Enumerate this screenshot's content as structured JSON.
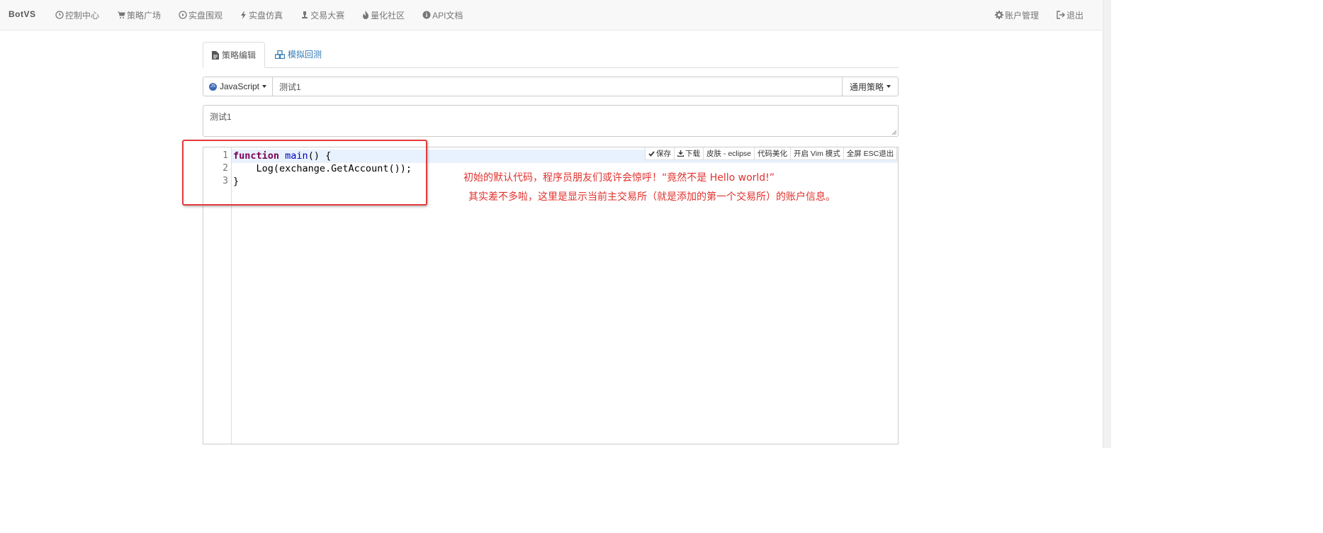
{
  "nav": {
    "brand": "BotVS",
    "items": [
      {
        "label": "控制中心",
        "icon": "clock-icon"
      },
      {
        "label": "策略广场",
        "icon": "cart-icon"
      },
      {
        "label": "实盘围观",
        "icon": "play-circle-icon"
      },
      {
        "label": "实盘仿真",
        "icon": "bolt-icon"
      },
      {
        "label": "交易大赛",
        "icon": "trophy-icon"
      },
      {
        "label": "量化社区",
        "icon": "fire-icon"
      },
      {
        "label": "API文档",
        "icon": "info-icon"
      }
    ],
    "right": [
      {
        "label": "账户管理",
        "icon": "gear-icon"
      },
      {
        "label": "退出",
        "icon": "logout-icon"
      }
    ]
  },
  "tabs": [
    {
      "label": "策略编辑",
      "icon": "file-icon",
      "active": true
    },
    {
      "label": "模拟回测",
      "icon": "cubes-icon",
      "active": false
    }
  ],
  "strategy": {
    "language": "JavaScript",
    "language_badge": "JS",
    "name": "测试1",
    "type": "通用策略",
    "description": "测试1"
  },
  "editor": {
    "toolbar": [
      {
        "label": "保存",
        "icon": "check-icon"
      },
      {
        "label": "下载",
        "icon": "download-icon"
      },
      {
        "label": "皮肤 - eclipse"
      },
      {
        "label": "代码美化"
      },
      {
        "label": "开启 Vim 模式"
      },
      {
        "label": "全屏 ESC退出"
      }
    ],
    "line_numbers": [
      "1",
      "2",
      "3"
    ],
    "code": [
      {
        "keyword": "function",
        "fn": "main",
        "rest": "() {"
      },
      {
        "text": "    Log(exchange.GetAccount());"
      },
      {
        "text": "}"
      }
    ]
  },
  "annotation": {
    "line1": "初始的默认代码，程序员朋友们或许会惊呼！“竟然不是 Hello world!”",
    "line2": "其实差不多啦，这里是显示当前主交易所（就是添加的第一个交易所）的账户信息。",
    "color": "#e0322e"
  }
}
